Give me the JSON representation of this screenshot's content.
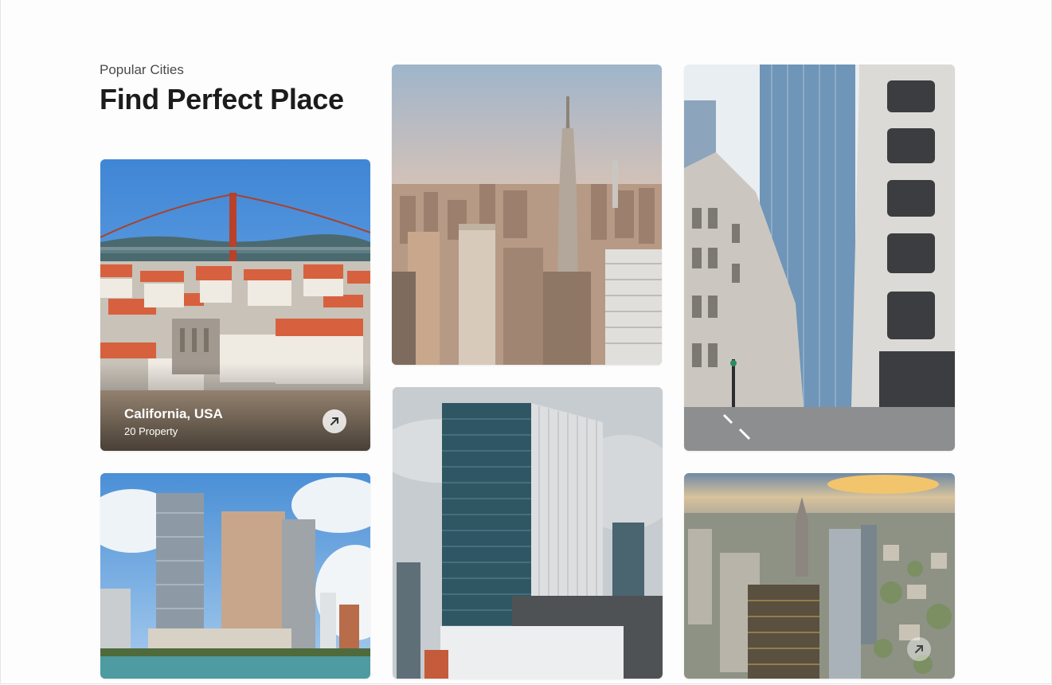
{
  "section": {
    "kicker": "Popular Cities",
    "title": "Find Perfect Place"
  },
  "cards": [
    {
      "id": "california",
      "name": "California, USA",
      "count": "20 Property",
      "scene": "bridge-hillside",
      "icon": "arrow-up-right-icon"
    },
    {
      "id": "new-york",
      "scene": "skyline-empire-state"
    },
    {
      "id": "london",
      "scene": "street-glass-tower"
    },
    {
      "id": "miami",
      "scene": "waterfront-highrise"
    },
    {
      "id": "tokyo",
      "scene": "glass-office-tower"
    },
    {
      "id": "frankfurt",
      "scene": "aerial-skyline-sunset",
      "icon": "arrow-up-right-icon"
    }
  ],
  "colors": {
    "heading": "#1c1c1c",
    "kicker": "#4a4a4a",
    "overlay_text": "#ffffff"
  }
}
